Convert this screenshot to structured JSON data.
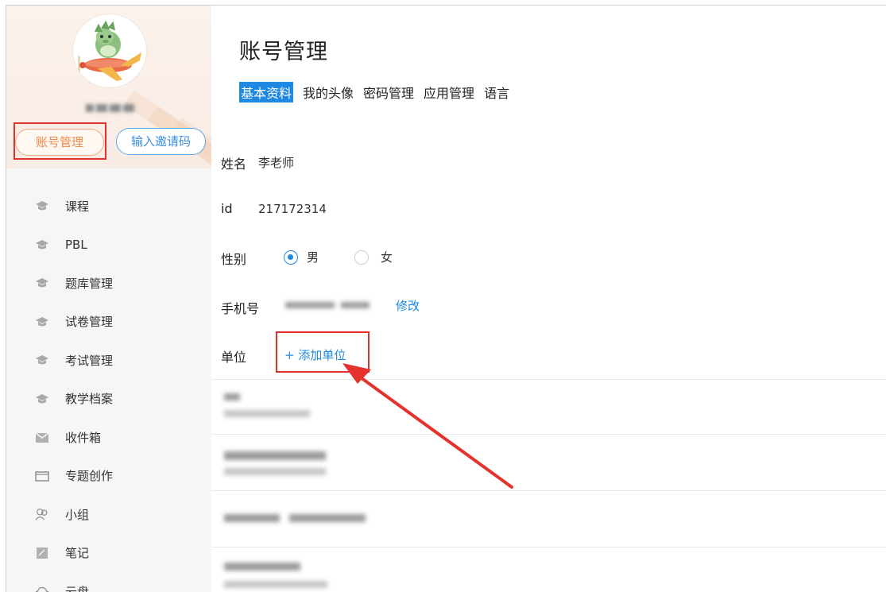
{
  "sidebar": {
    "account_button": "账号管理",
    "invite_button": "输入邀请码",
    "items": [
      {
        "label": "课程",
        "icon": "graduation-cap-icon"
      },
      {
        "label": "PBL",
        "icon": "graduation-cap-icon"
      },
      {
        "label": "题库管理",
        "icon": "graduation-cap-icon"
      },
      {
        "label": "试卷管理",
        "icon": "graduation-cap-icon"
      },
      {
        "label": "考试管理",
        "icon": "graduation-cap-icon"
      },
      {
        "label": "教学档案",
        "icon": "graduation-cap-icon"
      },
      {
        "label": "收件箱",
        "icon": "inbox-icon"
      },
      {
        "label": "专题创作",
        "icon": "window-icon"
      },
      {
        "label": "小组",
        "icon": "group-icon"
      },
      {
        "label": "笔记",
        "icon": "note-icon"
      },
      {
        "label": "云盘",
        "icon": "cloud-icon"
      }
    ]
  },
  "main": {
    "title": "账号管理",
    "tabs": [
      {
        "label": "基本资料",
        "active": true
      },
      {
        "label": "我的头像",
        "active": false
      },
      {
        "label": "密码管理",
        "active": false
      },
      {
        "label": "应用管理",
        "active": false
      },
      {
        "label": "语言",
        "active": false
      }
    ],
    "name_label": "姓名",
    "name_value": "李老师",
    "id_label": "id",
    "id_value": "217172314",
    "gender_label": "性别",
    "gender_options": [
      "男",
      "女"
    ],
    "gender_selected": "男",
    "phone_label": "手机号",
    "phone_edit": "修改",
    "unit_label": "单位",
    "add_unit": "+ 添加单位"
  },
  "colors": {
    "accent": "#1e88e5",
    "highlight": "#e0322c",
    "account_orange": "#f08a4b"
  }
}
